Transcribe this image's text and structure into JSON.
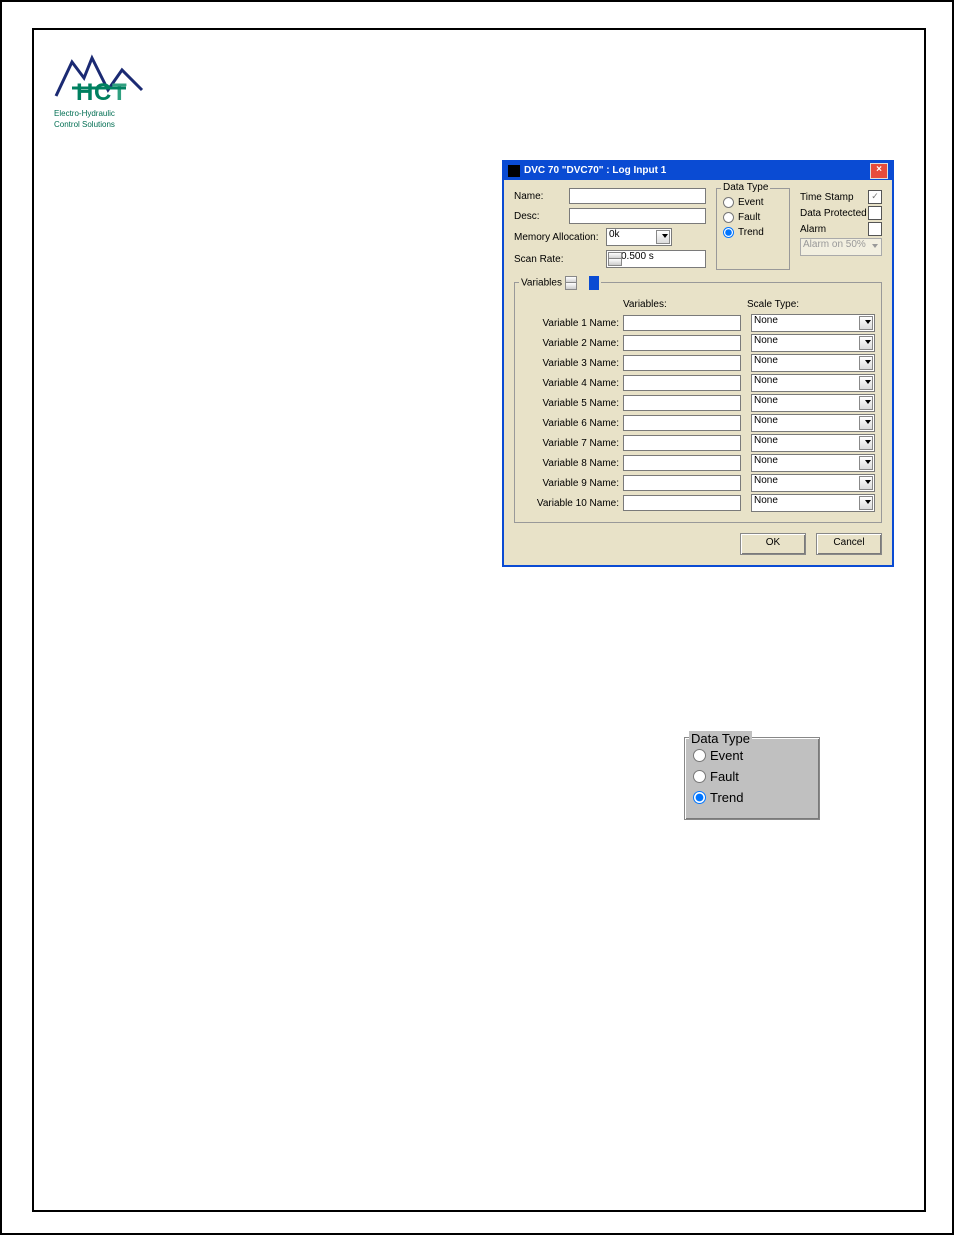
{
  "logo": {
    "line1": "Electro-Hydraulic",
    "line2": "Control Solutions",
    "brand": "HCT"
  },
  "dialog": {
    "title": "DVC 70 \"DVC70\" : Log Input 1",
    "name_label": "Name:",
    "name_value": "",
    "desc_label": "Desc:",
    "desc_value": "",
    "mem_label": "Memory Allocation:",
    "mem_value": "0k",
    "scan_label": "Scan Rate:",
    "scan_value": "0.500 s",
    "datatype": {
      "title": "Data Type",
      "event": "Event",
      "fault": "Fault",
      "trend": "Trend",
      "selected": "Trend"
    },
    "checks": {
      "ts_label": "Time Stamp",
      "ts_checked": true,
      "dp_label": "Data Protected",
      "dp_checked": false,
      "alarm_label": "Alarm",
      "alarm_checked": false,
      "alarm_sel": "Alarm on 50%"
    },
    "variables": {
      "title": "Variables",
      "hdr_var": "Variables:",
      "hdr_scale": "Scale Type:",
      "rows": [
        {
          "label": "Variable 1 Name:",
          "value": "",
          "scale": "None"
        },
        {
          "label": "Variable 2 Name:",
          "value": "",
          "scale": "None"
        },
        {
          "label": "Variable 3 Name:",
          "value": "",
          "scale": "None"
        },
        {
          "label": "Variable 4 Name:",
          "value": "",
          "scale": "None"
        },
        {
          "label": "Variable 5 Name:",
          "value": "",
          "scale": "None"
        },
        {
          "label": "Variable 6 Name:",
          "value": "",
          "scale": "None"
        },
        {
          "label": "Variable 7 Name:",
          "value": "",
          "scale": "None"
        },
        {
          "label": "Variable 8 Name:",
          "value": "",
          "scale": "None"
        },
        {
          "label": "Variable 9 Name:",
          "value": "",
          "scale": "None"
        },
        {
          "label": "Variable 10 Name:",
          "value": "",
          "scale": "None"
        }
      ]
    },
    "ok": "OK",
    "cancel": "Cancel"
  },
  "dtype_inset": {
    "title": "Data Type",
    "event": "Event",
    "fault": "Fault",
    "trend": "Trend",
    "selected": "Trend"
  }
}
